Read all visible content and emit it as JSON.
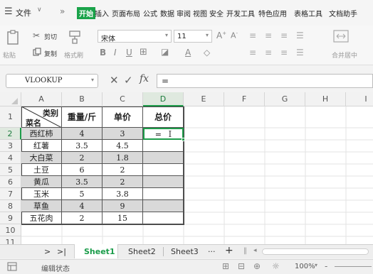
{
  "menu": {
    "hamburger_icon": "menu-icon",
    "file_label": "文件",
    "more_label": "»",
    "tabs": [
      "开始",
      "插入",
      "页面布局",
      "公式",
      "数据",
      "审阅",
      "视图",
      "安全",
      "开发工具",
      "特色应用",
      "表格工具",
      "文档助手"
    ],
    "active_tab": "开始",
    "accent_color": "#1aa34a"
  },
  "ribbon": {
    "cut_label": "剪切",
    "copy_label": "复制",
    "paste_label": "粘贴",
    "format_painter_label": "格式刷",
    "font_name": "宋体",
    "font_size": "11",
    "merge_label": "合并居中"
  },
  "formula_bar": {
    "name_box": "VLOOKUP",
    "cancel_symbol": "✕",
    "confirm_symbol": "✓",
    "fx_label": "fx",
    "content": "="
  },
  "grid": {
    "columns": [
      "A",
      "B",
      "C",
      "D",
      "E",
      "F",
      "G",
      "H",
      "I"
    ],
    "rows": [
      "1",
      "2",
      "3",
      "4",
      "5",
      "6",
      "7",
      "8",
      "9",
      "10",
      "11"
    ],
    "selected_col": "D",
    "selected_row": "2",
    "header_category_top": "类别",
    "header_category_bottom": "菜名",
    "header_weight": "重量/斤",
    "header_price": "单价",
    "header_total": "总价",
    "data": [
      [
        "西红柿",
        "4",
        "3",
        "="
      ],
      [
        "红薯",
        "3.5",
        "4.5",
        ""
      ],
      [
        "大白菜",
        "2",
        "1.8",
        ""
      ],
      [
        "土豆",
        "6",
        "2",
        ""
      ],
      [
        "黄瓜",
        "3.5",
        "2",
        ""
      ],
      [
        "玉米",
        "5",
        "3.8",
        ""
      ],
      [
        "草鱼",
        "4",
        "9",
        ""
      ],
      [
        "五花肉",
        "2",
        "15",
        ""
      ]
    ]
  },
  "sheets": {
    "nav_next": ">",
    "nav_last": ">|",
    "tabs": [
      "Sheet1",
      "Sheet2",
      "Sheet3"
    ],
    "active": "Sheet1",
    "more": "···",
    "add": "+"
  },
  "status": {
    "mode": "编辑状态",
    "zoom": "100%",
    "zoom_minus": "-"
  }
}
